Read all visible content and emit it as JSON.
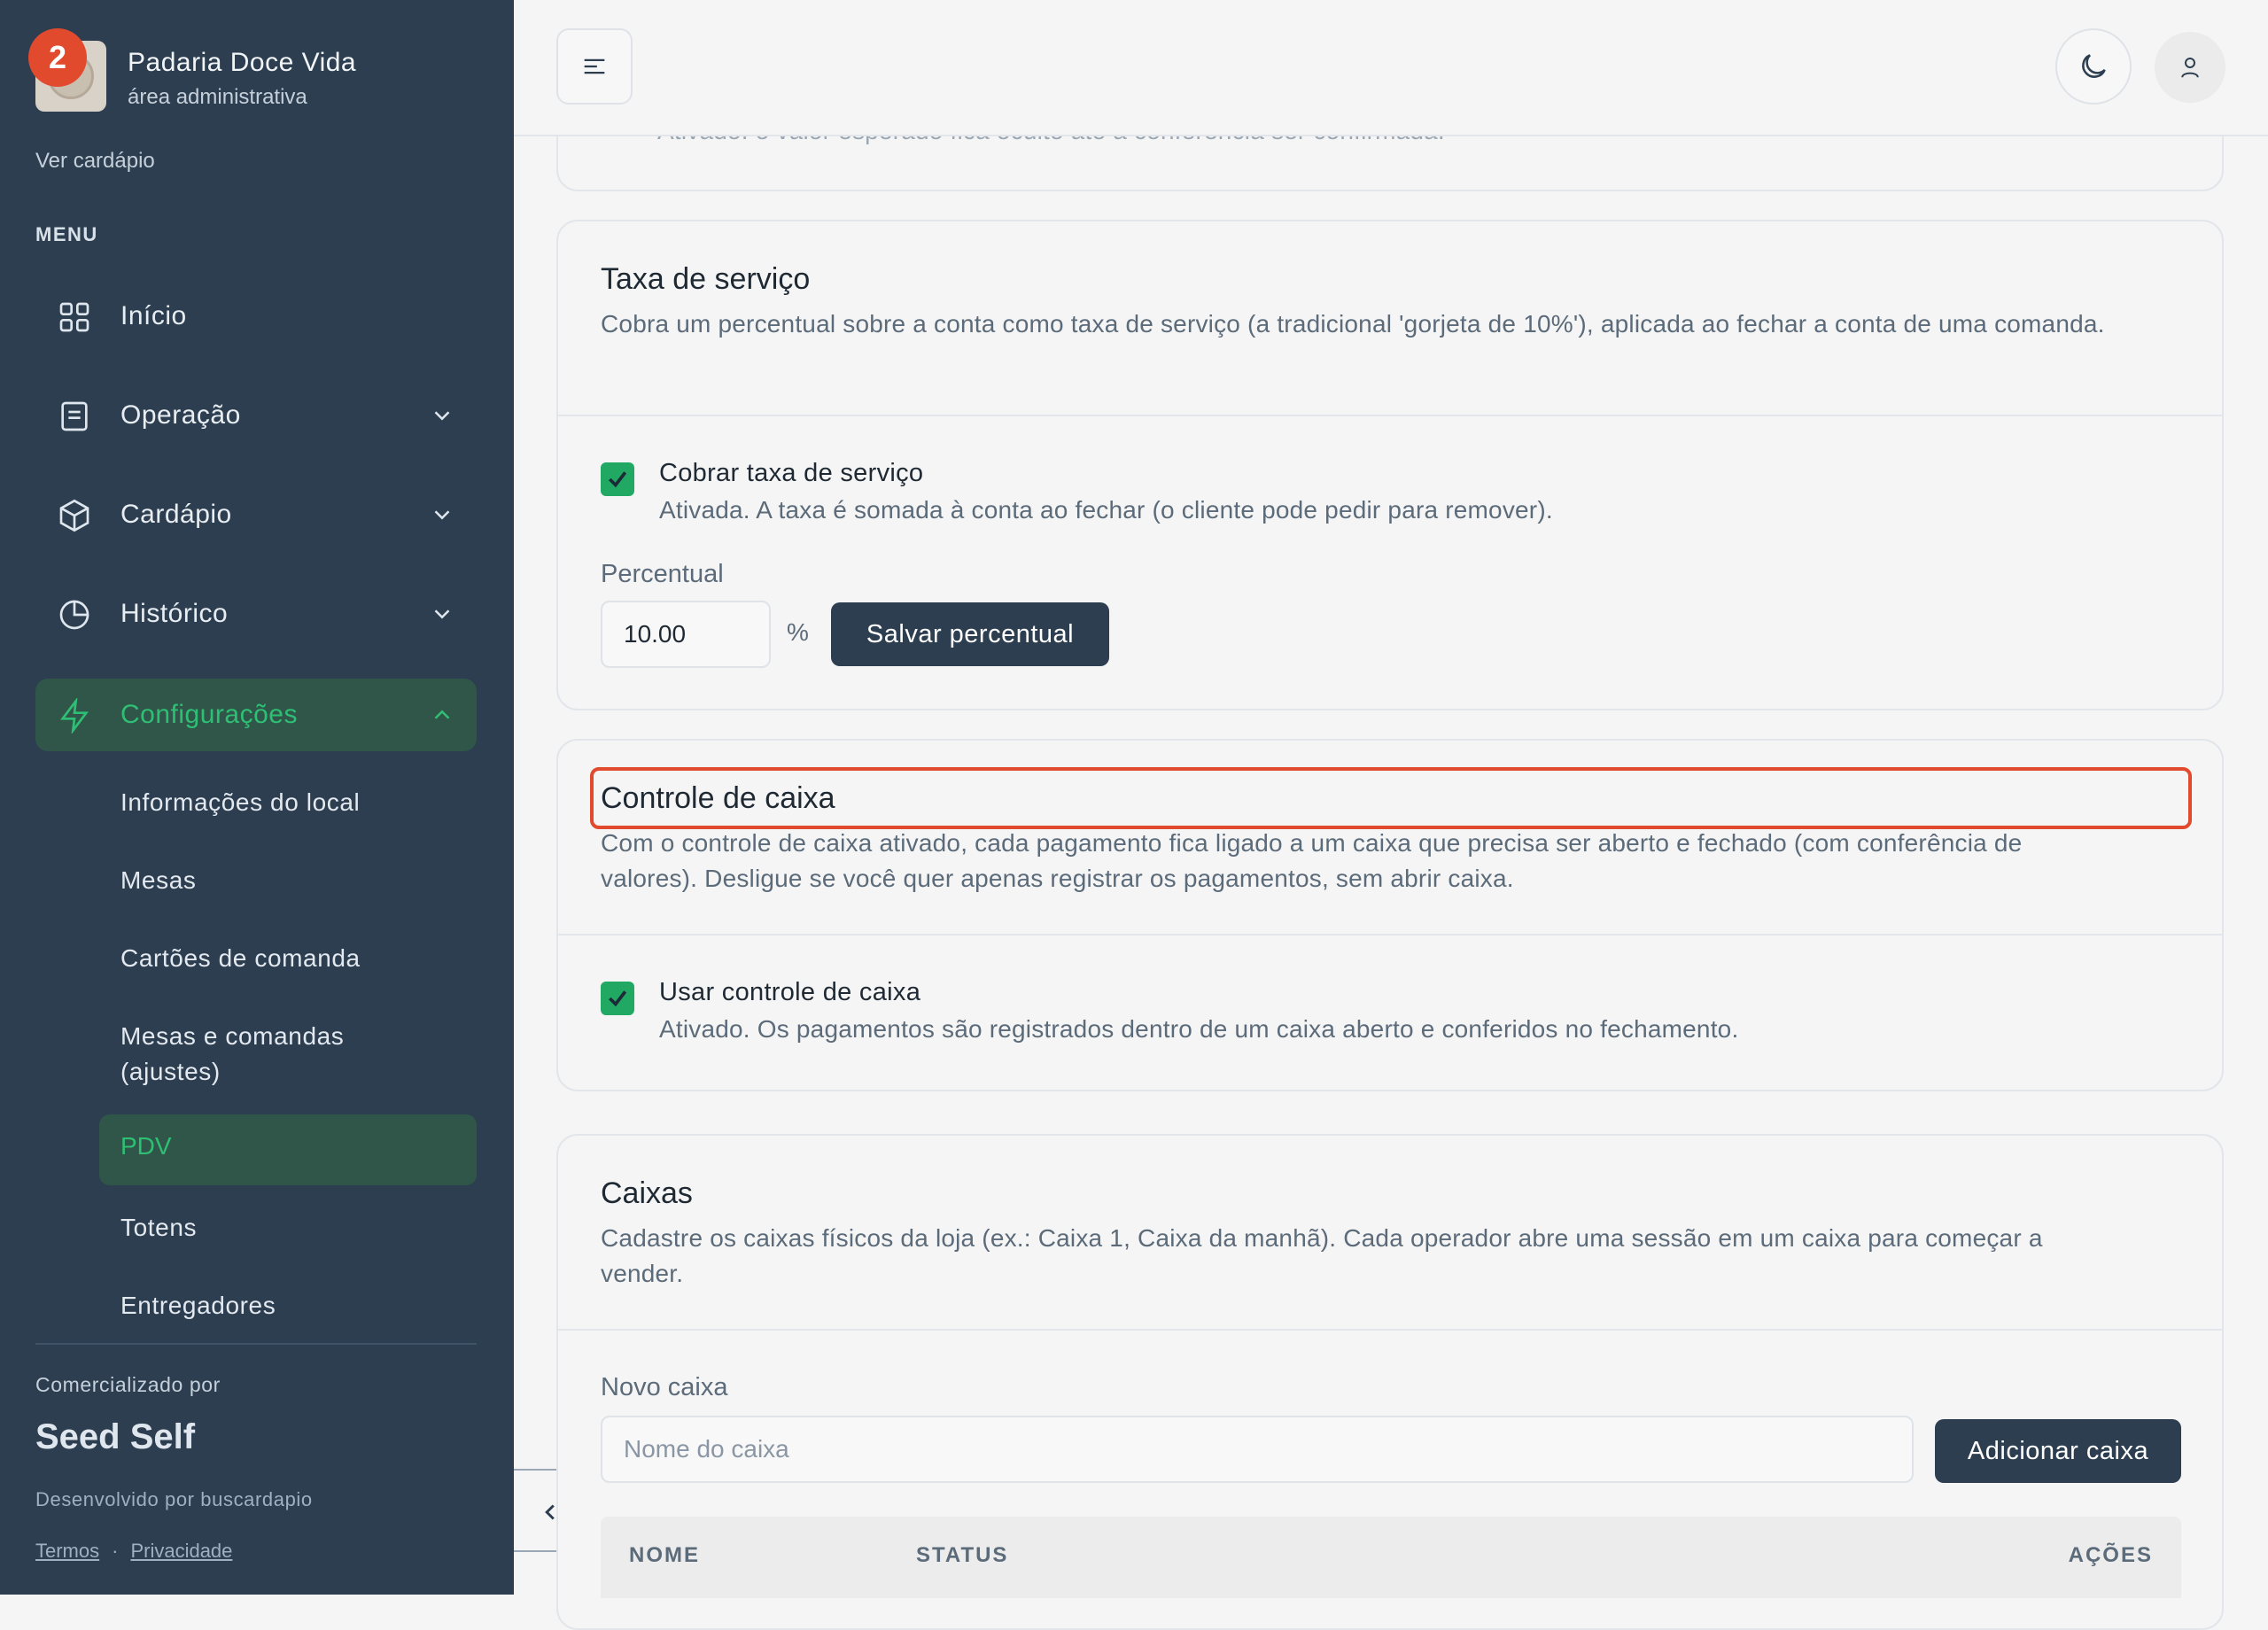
{
  "sidebar": {
    "notification_count": "2",
    "brand_name": "Padaria Doce Vida",
    "brand_subtitle": "área administrativa",
    "view_menu_link": "Ver cardápio",
    "menu_heading": "MENU",
    "nav": [
      {
        "label": "Início",
        "icon": "grid-icon"
      },
      {
        "label": "Operação",
        "icon": "document-icon"
      },
      {
        "label": "Cardápio",
        "icon": "box-icon"
      },
      {
        "label": "Histórico",
        "icon": "pie-chart-icon"
      },
      {
        "label": "Configurações",
        "icon": "lightning-icon"
      }
    ],
    "settings_items": [
      "Informações do local",
      "Mesas",
      "Cartões de comanda",
      "Mesas e comandas (ajustes)",
      "PDV",
      "Totens",
      "Entregadores"
    ],
    "active_settings_item": "PDV",
    "commercialized_by": "Comercializado por",
    "partner_brand": "Seed Self",
    "developed_by": "Desenvolvido por buscardapio",
    "terms_link": "Termos",
    "separator": "·",
    "privacy_link": "Privacidade"
  },
  "topbar": {
    "menu_icon": "hamburger-icon",
    "theme_icon": "moon-icon",
    "profile_icon": "user-icon"
  },
  "cards": {
    "previous_note": "Ativado: o valor esperado fica oculto até a conferência ser confirmada.",
    "service_fee": {
      "title": "Taxa de serviço",
      "description": "Cobra um percentual sobre a conta como taxa de serviço (a tradicional 'gorjeta de 10%'), aplicada ao fechar a conta de uma comanda.",
      "checkbox_label": "Cobrar taxa de serviço",
      "checkbox_checked": true,
      "checkbox_help": "Ativada. A taxa é somada à conta ao fechar (o cliente pode pedir para remover).",
      "percent_label": "Percentual",
      "percent_value": "10.00",
      "percent_symbol": "%",
      "save_button": "Salvar percentual"
    },
    "cash_control": {
      "title": "Controle de caixa",
      "description": "Com o controle de caixa ativado, cada pagamento fica ligado a um caixa que precisa ser aberto e fechado (com conferência de valores). Desligue se você quer apenas registrar os pagamentos, sem abrir caixa.",
      "checkbox_label": "Usar controle de caixa",
      "checkbox_checked": true,
      "checkbox_help": "Ativado. Os pagamentos são registrados dentro de um caixa aberto e conferidos no fechamento."
    },
    "registers": {
      "title": "Caixas",
      "description": "Cadastre os caixas físicos da loja (ex.: Caixa 1, Caixa da manhã). Cada operador abre uma sessão em um caixa para começar a vender.",
      "new_label": "Novo caixa",
      "new_placeholder": "Nome do caixa",
      "add_button": "Adicionar caixa",
      "columns": [
        "NOME",
        "STATUS",
        "AÇÕES"
      ]
    }
  },
  "colors": {
    "sidebar_bg": "#2c3e50",
    "accent_green": "#2fbf74",
    "checkbox_green": "#21a862",
    "highlight_red": "#e24a2e",
    "button_dark": "#2c3e50"
  }
}
